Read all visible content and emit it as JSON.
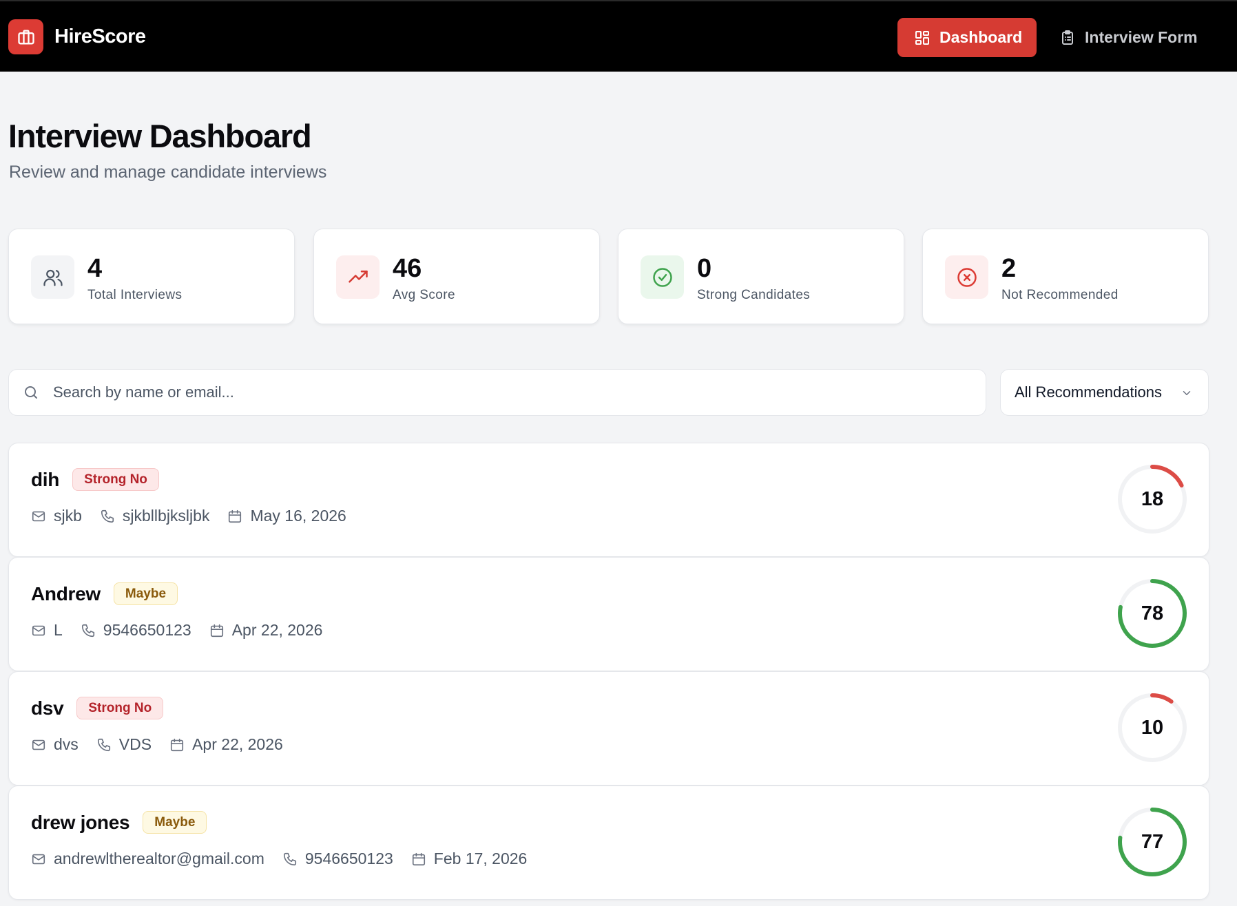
{
  "app": {
    "name": "HireScore"
  },
  "nav": {
    "dashboard": "Dashboard",
    "interview_form": "Interview Form"
  },
  "page": {
    "title": "Interview Dashboard",
    "subtitle": "Review and manage candidate interviews"
  },
  "stats": [
    {
      "value": "4",
      "label": "Total Interviews",
      "icon": "users-icon"
    },
    {
      "value": "46",
      "label": "Avg Score",
      "icon": "trending-up-icon"
    },
    {
      "value": "0",
      "label": "Strong Candidates",
      "icon": "check-circle-icon"
    },
    {
      "value": "2",
      "label": "Not Recommended",
      "icon": "x-circle-icon"
    }
  ],
  "search": {
    "placeholder": "Search by name or email...",
    "value": ""
  },
  "filter": {
    "selected": "All Recommendations"
  },
  "colors": {
    "brand": "#dc3b34",
    "score_low": "#dc4c46",
    "score_mid": "#3fa34d",
    "badge_no": "#b4232a",
    "badge_maybe": "#8a5a0b"
  },
  "interviews": [
    {
      "name": "dih",
      "recommendation": "Strong No",
      "email": "sjkb",
      "phone": "sjkbllbjksljbk",
      "date": "May 16, 2026",
      "score": 18
    },
    {
      "name": "Andrew",
      "recommendation": "Maybe",
      "email": "L",
      "phone": "9546650123",
      "date": "Apr 22, 2026",
      "score": 78
    },
    {
      "name": "dsv",
      "recommendation": "Strong No",
      "email": "dvs",
      "phone": "VDS",
      "date": "Apr 22, 2026",
      "score": 10
    },
    {
      "name": "drew jones",
      "recommendation": "Maybe",
      "email": "andrewltherealtor@gmail.com",
      "phone": "9546650123",
      "date": "Feb 17, 2026",
      "score": 77
    }
  ]
}
